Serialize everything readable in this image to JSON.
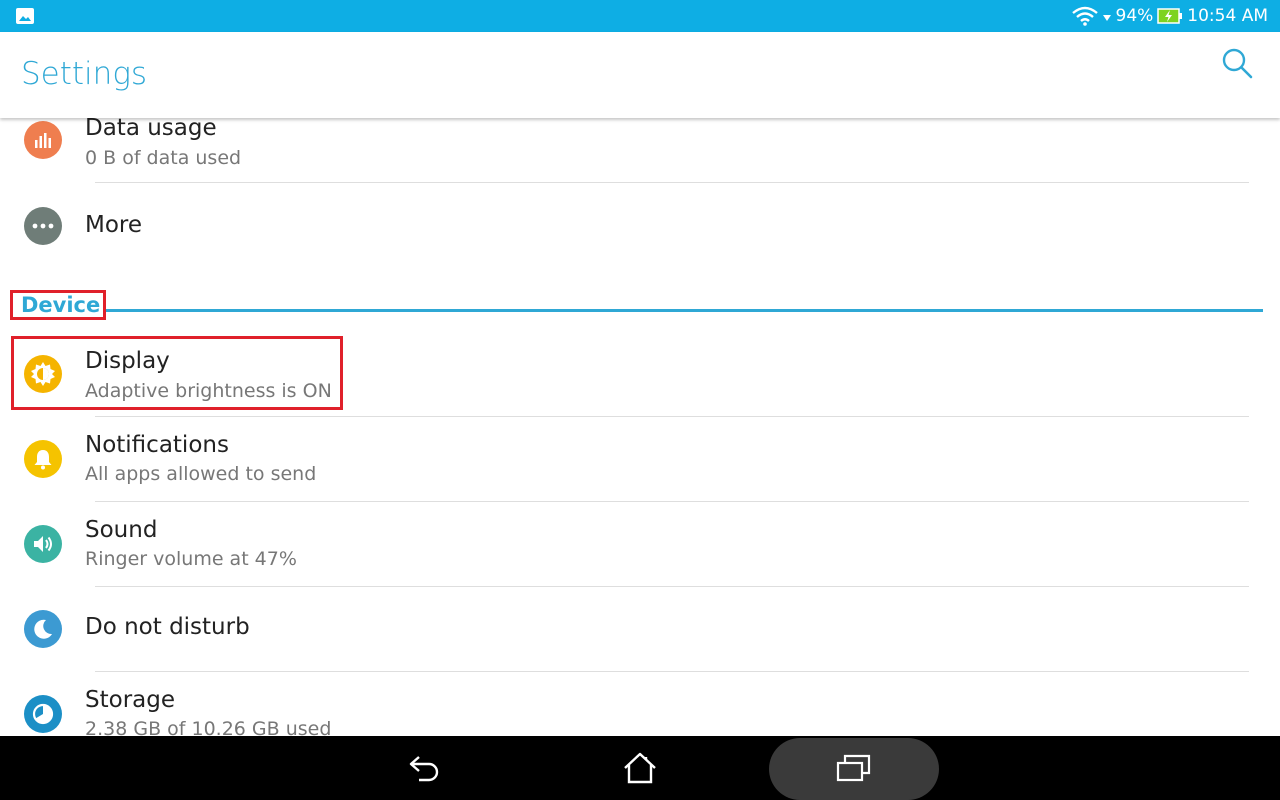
{
  "status": {
    "battery": "94%",
    "time": "10:54 AM"
  },
  "toolbar": {
    "title": "Settings",
    "search_icon": "search-icon"
  },
  "list": {
    "data_usage": {
      "label": "Data usage",
      "sub": "0 B of data used",
      "icon": "bar-chart-icon",
      "color": "#ef7e4f"
    },
    "more": {
      "label": "More",
      "icon": "more-dots-icon",
      "color": "#6f7d78"
    },
    "section_device": "Device",
    "display": {
      "label": "Display",
      "sub": "Adaptive brightness is ON",
      "icon": "brightness-icon",
      "color": "#f5b400"
    },
    "notifications": {
      "label": "Notifications",
      "sub": "All apps allowed to send",
      "icon": "bell-icon",
      "color": "#f5c300"
    },
    "sound": {
      "label": "Sound",
      "sub": "Ringer volume at 47%",
      "icon": "speaker-icon",
      "color": "#3bb3a3"
    },
    "dnd": {
      "label": "Do not disturb",
      "icon": "moon-icon",
      "color": "#3c9ad2"
    },
    "storage": {
      "label": "Storage",
      "sub": "2.38 GB of 10.26 GB used",
      "icon": "storage-pie-icon",
      "color": "#1c8fc6"
    }
  },
  "colors": {
    "accent": "#2fa8d5",
    "status_bar": "#0eaee4",
    "highlight": "#e0202a"
  },
  "navbar": {
    "back": "back-icon",
    "home": "home-icon",
    "recents": "recents-icon"
  }
}
